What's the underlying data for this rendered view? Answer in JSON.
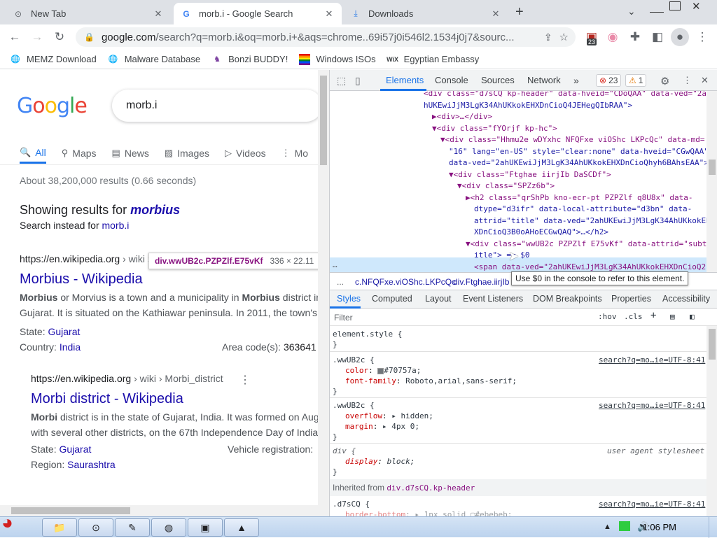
{
  "tabs": [
    {
      "title": "New Tab",
      "icon": "chrome-icon"
    },
    {
      "title": "morb.i - Google Search",
      "icon": "google-g-icon"
    },
    {
      "title": "Downloads",
      "icon": "download-icon"
    }
  ],
  "address_bar": {
    "url_host": "google.com",
    "url_rest": "/search?q=morb.i&oq=morb.i+&aqs=chrome..69i57j0i546l2.1534j0j7&sourc..."
  },
  "extension_badge": "23",
  "bookmarks": [
    {
      "label": "MEMZ Download"
    },
    {
      "label": "Malware Database"
    },
    {
      "label": "Bonzi BUDDY!"
    },
    {
      "label": "Windows ISOs"
    },
    {
      "label": "Egyptian Embassy"
    }
  ],
  "google": {
    "logo": [
      "G",
      "o",
      "o",
      "g",
      "l",
      "e"
    ],
    "logo_colors": [
      "#4285f4",
      "#ea4335",
      "#fbbc05",
      "#4285f4",
      "#34a853",
      "#ea4335"
    ],
    "query": "morb.i",
    "tabs": [
      "All",
      "Maps",
      "News",
      "Images",
      "Videos",
      "Mo"
    ],
    "stats": "About 38,200,000 results (0.66 seconds)",
    "showing_prefix": "Showing results for",
    "showing_term": "morbius",
    "instead_prefix": "Search instead for",
    "instead_term": "morb.i",
    "results": [
      {
        "url": "https://en.wikipedia.org",
        "crumb": " › wiki › Morbi",
        "title": "Morbius - Wikipedia",
        "snippet1_b1": "Morbius",
        "snippet1_t1": " or Morvius is a town and a municipality in ",
        "snippet1_b2": "Morbius",
        "snippet1_t2": " district in",
        "snippet2": "Gujarat. It is situated on the Kathiawar peninsula. In 2011, the town's",
        "kv": [
          {
            "k": "State: ",
            "v": "Gujarat"
          },
          {
            "k": "Country: ",
            "v": "India"
          },
          {
            "k": "Area code(s): ",
            "v": "363641"
          }
        ]
      },
      {
        "url": "https://en.wikipedia.org",
        "crumb": " › wiki › Morbi_district",
        "title": "Morbi district - Wikipedia",
        "snippet1_b1": "Morbi",
        "snippet1_t1": " district is in the state of Gujarat, India. It was formed on Aug",
        "snippet2": "with several other districts, on the 67th Independence Day of India",
        "kv": [
          {
            "k": "State: ",
            "v": "Gujarat"
          },
          {
            "k": "Vehicle registration: ",
            "v": ""
          },
          {
            "k": "Region: ",
            "v": "Saurashtra"
          }
        ]
      }
    ]
  },
  "hover_tooltip": {
    "selector": "div.wwUB2c.PZPZlf.E75vKf",
    "size": "336 × 22.11"
  },
  "devtools": {
    "tabs": [
      "Elements",
      "Console",
      "Sources",
      "Network"
    ],
    "errors": "23",
    "warnings": "1",
    "dom_lines": [
      {
        "t": "<div class=\"d7sCQ kp-header\" data-hveid=\"CDoQAA\" data-ved=\"2a",
        "i": 0,
        "cls": "tg"
      },
      {
        "t": "hUKEwiJjM3LgK34AhUKkokEHXDnCioQ4JEHegQIbRAA\">",
        "i": 0,
        "cls": "av"
      },
      {
        "t": "▶<div>…</div>",
        "i": 1,
        "cls": "tg"
      },
      {
        "t": "▼<div class=\"fYOrjf kp-hc\">",
        "i": 1,
        "cls": "tg"
      },
      {
        "t": "▼<div class=\"Hhmu2e wDYxhc NFQFxe viOShc LKPcQc\" data-md=",
        "i": 2,
        "cls": "tg"
      },
      {
        "t": "\"16\" lang=\"en-US\" style=\"clear:none\" data-hveid=\"CGwQAA\"",
        "i": 3,
        "cls": "av"
      },
      {
        "t": "data-ved=\"2ahUKEwiJjM3LgK34AhUKkokEHXDnCioQhyh6BAhsEAA\">",
        "i": 3,
        "cls": "av"
      },
      {
        "t": "▼<div class=\"Ftghae iirjIb DaSCDf\">",
        "i": 3,
        "cls": "tg"
      },
      {
        "t": "▼<div class=\"SPZz6b\">",
        "i": 4,
        "cls": "tg"
      },
      {
        "t": "▶<h2 class=\"qrShPb kno-ecr-pt PZPZlf q8U8x\" data-",
        "i": 5,
        "cls": "tg"
      },
      {
        "t": "dtype=\"d3ifr\" data-local-attribute=\"d3bn\" data-",
        "i": 6,
        "cls": "av"
      },
      {
        "t": "attrid=\"title\" data-ved=\"2ahUKEwiJjM3LgK34AhUKkokEH",
        "i": 6,
        "cls": "av"
      },
      {
        "t": "XDnCioQ3B0oAHoECGwQAQ\">…</h2>",
        "i": 6,
        "cls": "av"
      },
      {
        "t": "▼<div class=\"wwUB2c PZPZlf E75vKf\" data-attrid=\"subt",
        "i": 5,
        "cls": "tg"
      },
      {
        "t": "itle\"> == $0",
        "i": 6,
        "cls": "av"
      },
      {
        "t": "<span data-ved=\"2ahUKEwiJjM3LgK34AhUKkokEHXDnCioQ2",
        "i": 6,
        "cls": "tg"
      }
    ],
    "breadcrumbs": [
      "...",
      "c.NFQFxe.viOShc.LKPcQc",
      "div.Ftghae.iirjIb"
    ],
    "tooltip": "Use $0 in the console to refer to this element.",
    "styles_tabs": [
      "Styles",
      "Computed",
      "Layout",
      "Event Listeners",
      "DOM Breakpoints",
      "Properties",
      "Accessibility"
    ],
    "filter_placeholder": "Filter",
    "hov": ":hov",
    "cls": ".cls",
    "rules": {
      "element_style": "element.style {",
      "r1_sel": ".wwUB2c {",
      "r1_src": "search?q=mo…ie=UTF-8:41",
      "r1_p1n": "color",
      "r1_p1v": "#70757a;",
      "r1_p2n": "font-family",
      "r1_p2v": "Roboto,arial,sans-serif;",
      "r2_sel": ".wwUB2c {",
      "r2_src": "search?q=mo…ie=UTF-8:41",
      "r2_p1n": "overflow",
      "r2_p1v": "▸ hidden;",
      "r2_p2n": "margin",
      "r2_p2v": "▸ 4px 0;",
      "r3_sel": "div {",
      "r3_src": "user agent stylesheet",
      "r3_p1n": "display",
      "r3_p1v": "block;",
      "inherited_prefix": "Inherited from",
      "inherited_from": "div.d7sCQ.kp-header",
      "r4_sel": ".d7sCQ {",
      "r4_src": "search?q=mo…ie=UTF-8:41",
      "r4_p1n": "border-bottom",
      "r4_p1v": "▸ 1px solid ▢#ebebeb;",
      "close": "}"
    }
  },
  "taskbar": {
    "time": "1:06 PM"
  },
  "colors": {
    "accent": "#1a73e8",
    "link": "#1a0dab",
    "swatch": "#70757a"
  }
}
